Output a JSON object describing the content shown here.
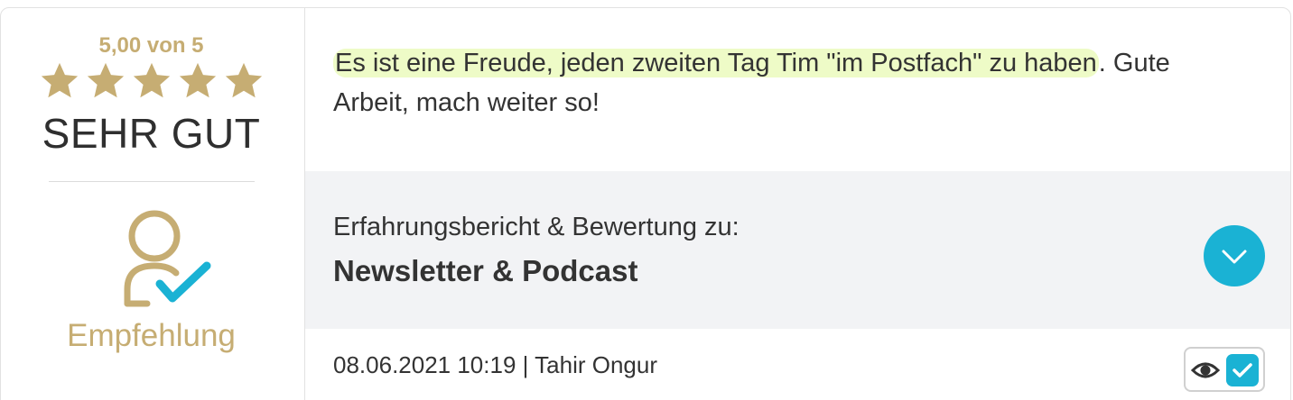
{
  "rating": {
    "score_label": "5,00 von 5",
    "stars": 5,
    "max_stars": 5,
    "verdict": "SEHR GUT"
  },
  "recommendation": {
    "icon": "user-check-icon",
    "label": "Empfehlung"
  },
  "review": {
    "highlighted_text": "Es ist eine Freude, jeden zweiten Tag Tim \"im Postfach\" zu haben",
    "rest_text": ". Gute Arbeit, mach weiter so!"
  },
  "product": {
    "caption": "Erfahrungsbericht & Bewertung zu:",
    "name": "Newsletter & Podcast",
    "expand_icon": "chevron-down-icon"
  },
  "meta": {
    "line": "08.06.2021 10:19 | Tahir Ongur"
  },
  "tools": {
    "view_icon": "eye-icon",
    "verified_icon": "check-icon"
  },
  "colors": {
    "gold": "#c6ad73",
    "accent": "#1ab2d4",
    "highlight": "#eefbc7",
    "panel": "#f2f3f5"
  }
}
